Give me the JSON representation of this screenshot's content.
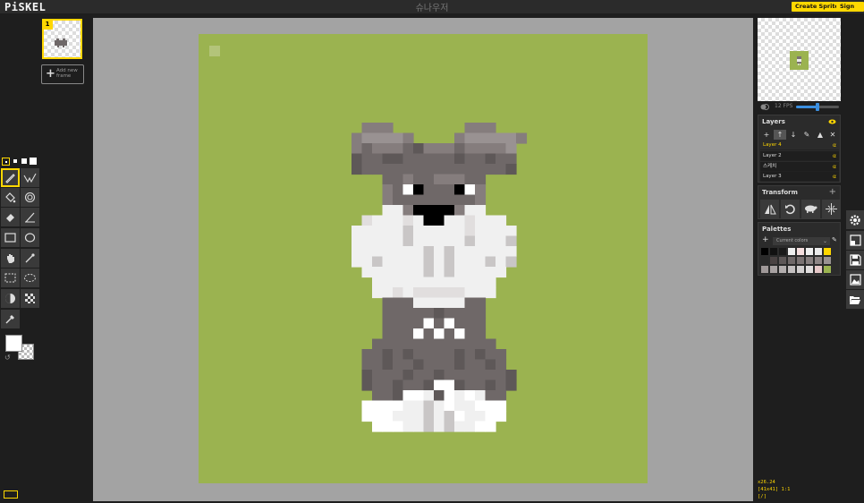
{
  "app": {
    "logo": "PiSKEL",
    "doc_title": "슈나우저"
  },
  "header": {
    "create_sprite_label": "Create Sprite",
    "sign_in_label": "Sign in"
  },
  "frames": {
    "current_frame_number": "1",
    "add_frame_label": "Add new frame"
  },
  "tools": {
    "pen_sizes": [
      "1",
      "2",
      "3",
      "4"
    ],
    "items": [
      "pen",
      "vertical-mirror",
      "paint-bucket",
      "paint-same-color",
      "eraser",
      "stroke",
      "rectangle",
      "circle",
      "move",
      "shape-select",
      "rectangle-select",
      "lasso-select",
      "lighten",
      "dithering",
      "color-picker"
    ],
    "selected": "pen",
    "primary_color": "#ffffff",
    "secondary_color": "transparent"
  },
  "preview": {
    "fps_label": "12 FPS",
    "fps_value": 12,
    "fps_max": 24
  },
  "layers": {
    "title": "Layers",
    "items": [
      {
        "name": "Layer 4",
        "alpha": "α",
        "selected": true
      },
      {
        "name": "Layer 2",
        "alpha": "α",
        "selected": false
      },
      {
        "name": "스케치",
        "alpha": "α",
        "selected": false
      },
      {
        "name": "Layer 3",
        "alpha": "α",
        "selected": false
      }
    ]
  },
  "transform": {
    "title": "Transform",
    "tools": [
      "flip",
      "rotate",
      "clone",
      "align"
    ]
  },
  "palettes": {
    "title": "Palettes",
    "current": "Current colors",
    "colors": [
      "#000000",
      "#111111",
      "#1a1a1a",
      "#eeeeee",
      "#f5dede",
      "#f0f0f0",
      "#eaeaea",
      "#ffd700",
      "#2a2a2a",
      "#4a4343",
      "#5e5858",
      "#6f6868",
      "#7a7272",
      "#867e7e",
      "#8d8585",
      "#999292",
      "#9f9898",
      "#a8a2a2",
      "#b3aeae",
      "#c4c0c0",
      "#d2cfcf",
      "#e1dede",
      "#e6c8c8",
      "#9bb350"
    ]
  },
  "status": {
    "cursor": "x26.24",
    "size_zoom": "[41x41] 1:1",
    "frame": "[/]"
  },
  "canvas": {
    "background_color": "#9bb350"
  }
}
